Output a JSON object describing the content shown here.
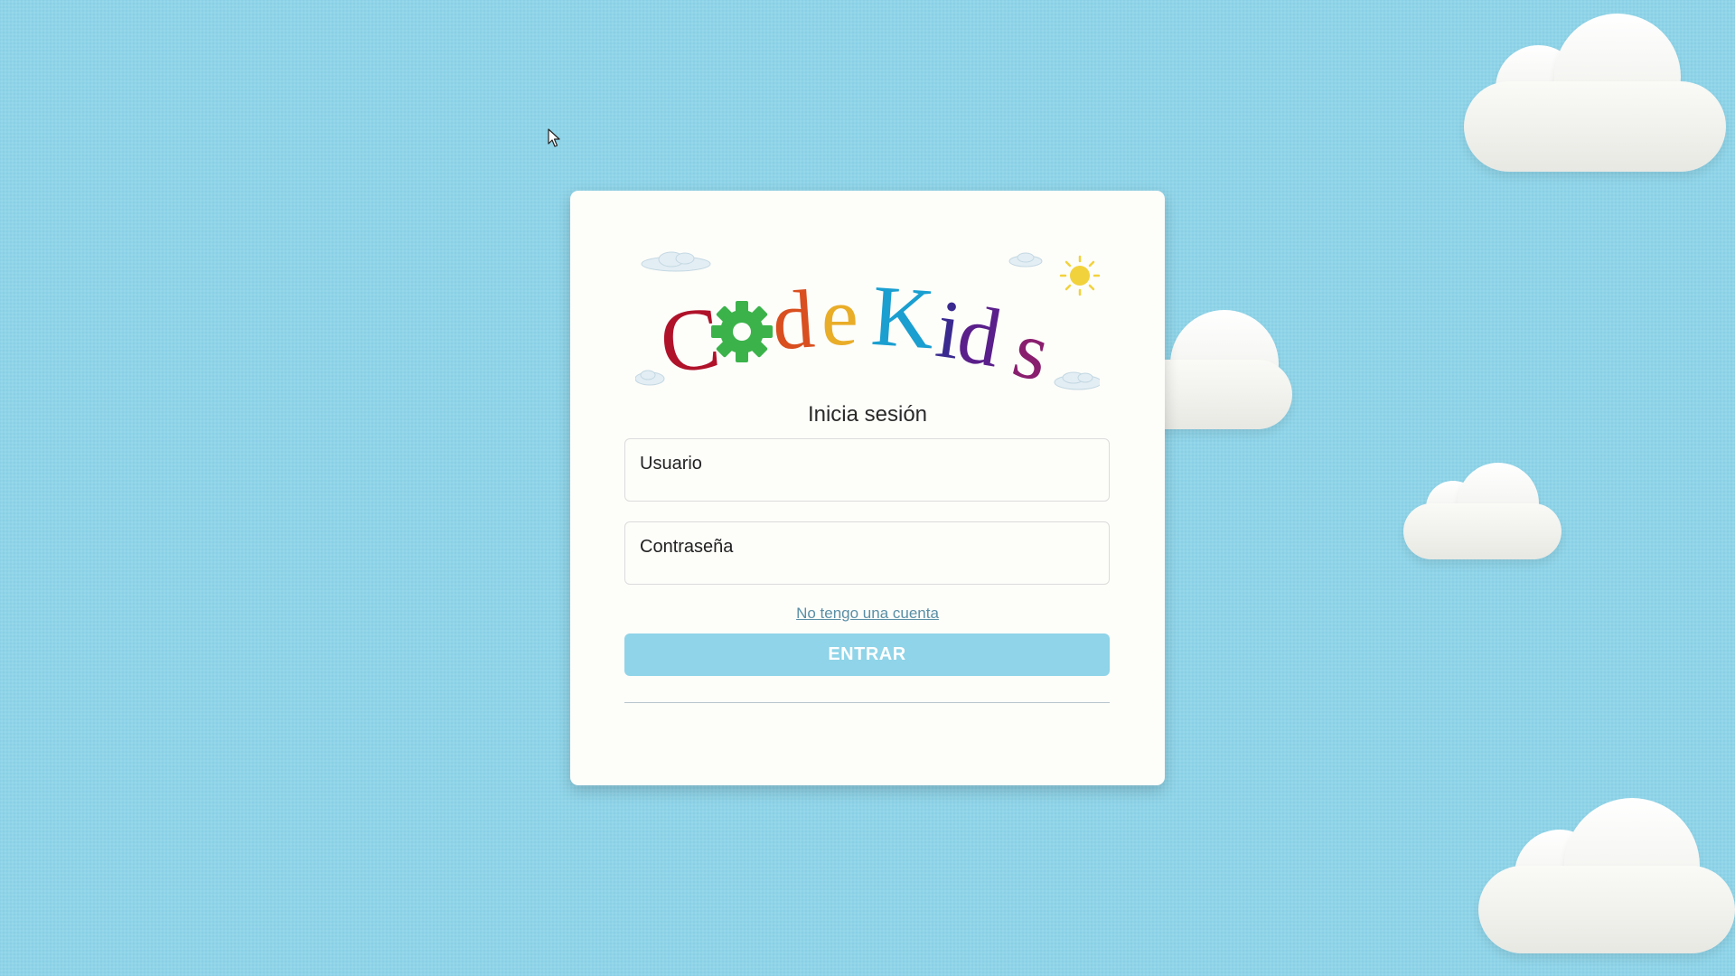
{
  "brand": {
    "name": "CodeKids",
    "letters": [
      "C",
      "d",
      "e",
      "K",
      "i",
      "d",
      "s"
    ],
    "letter_colors": [
      "#b0122a",
      "#d94f1f",
      "#e9ad28",
      "#1a9fd0",
      "#3a2a8f",
      "#5a1f8a",
      "#8a1e6e"
    ],
    "gear_color": "#3bb34a",
    "sun_color": "#f2d23c"
  },
  "login": {
    "title": "Inicia sesión",
    "username_placeholder": "Usuario",
    "password_placeholder": "Contraseña",
    "register_link": "No tengo una cuenta",
    "submit_label": "ENTRAR"
  },
  "colors": {
    "background": "#8fd4e8",
    "card": "#fdfdfa",
    "button": "#8fd4e8",
    "link": "#5a8fa6"
  },
  "icons": {
    "cursor": "arrow-cursor-icon",
    "gear": "gear-icon",
    "sun": "sun-icon",
    "cloud": "cloud-icon"
  }
}
